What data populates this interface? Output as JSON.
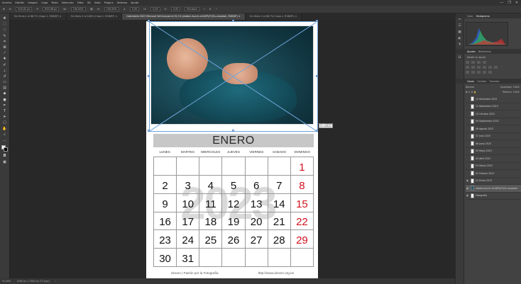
{
  "menubar": {
    "items": [
      "Archivo",
      "Edición",
      "Imagen",
      "Capa",
      "Texto",
      "Selección",
      "Filtro",
      "3D",
      "Vista",
      "Plugins",
      "Ventana",
      "Ayuda"
    ],
    "window_buttons": [
      "—",
      "❐",
      "✕"
    ]
  },
  "options_bar": {
    "fields": [
      "X:",
      "403,02 px",
      "Y:",
      "623,08 px",
      "W:",
      "100,00%",
      "H:",
      "100,00%",
      "0,00",
      "H:",
      "0,00",
      "V:",
      "0,00",
      "Bicúbica"
    ]
  },
  "doc_tabs": [
    {
      "label": "Sin título-1 al 66,7% (Capa 1, RGB/8*) ×",
      "active": false
    },
    {
      "label": "Sin título-2 al 100% (Capa 1, RGB/8*) ×",
      "active": false
    },
    {
      "label": "Calendario 2023 Mensual Vertical.psd al 92,1% (adobe-mucric-ml4DPyF2j3s-unsplash, RGB/8*) ×",
      "active": true
    },
    {
      "label": "Sin título-3 al 66,7% (Capa 1, RGB/8*) ×",
      "active": false
    }
  ],
  "status_bar": {
    "zoom": "92,08%",
    "doc_info": "1000 px x 1300 px (72 ppp)"
  },
  "transform_info": {
    "line1": "An.: 1345 px",
    "line2": "Al.: 1195 px"
  },
  "calendar": {
    "month": "ENERO",
    "day_names": [
      "LUNES",
      "MARTES",
      "MIERCOLES",
      "JUEVES",
      "VIERNES",
      "SABADO",
      "DOMINGO"
    ],
    "weeks": [
      [
        "",
        "",
        "",
        "",
        "",
        "",
        "1"
      ],
      [
        "2",
        "3",
        "4",
        "5",
        "6",
        "7",
        "8"
      ],
      [
        "9",
        "10",
        "11",
        "12",
        "13",
        "14",
        "15"
      ],
      [
        "16",
        "17",
        "18",
        "19",
        "20",
        "21",
        "22"
      ],
      [
        "23",
        "24",
        "25",
        "26",
        "27",
        "28",
        "29"
      ],
      [
        "30",
        "31",
        "",
        "",
        "",
        "",
        ""
      ]
    ],
    "watermark_year": "2023",
    "footer_left": "dzoom | Pasión por la Fotografía",
    "footer_right": "http://www.dzoom.org.es",
    "sunday_color": "#d2121e"
  },
  "right_panel": {
    "top_tabs": [
      "Color",
      "Histograma"
    ],
    "adjust_tabs": [
      "Ajustes",
      "Bibliotecas"
    ],
    "adjust_label": "Añadir un ajuste",
    "layer_tabs": [
      "Capas",
      "Canales",
      "Trazados"
    ],
    "blend_mode": "Normal",
    "opacity": "Opacidad: 100%",
    "fill": "Relleno: 100%",
    "layers": [
      {
        "name": "12 Diciembre 2023",
        "selected": false
      },
      {
        "name": "11 Noviembre 2023",
        "selected": false
      },
      {
        "name": "10 Octubre 2023",
        "selected": false
      },
      {
        "name": "09 Septiembre 2023",
        "selected": false
      },
      {
        "name": "08 Agosto 2023",
        "selected": false
      },
      {
        "name": "07 Julio 2023",
        "selected": false
      },
      {
        "name": "06 Junio 2023",
        "selected": false
      },
      {
        "name": "05 Mayo 2023",
        "selected": false
      },
      {
        "name": "04 Abril 2023",
        "selected": false
      },
      {
        "name": "03 Marzo 2023",
        "selected": false
      },
      {
        "name": "02 Febrero 2023",
        "selected": false
      },
      {
        "name": "01 Enero 2023",
        "selected": false
      },
      {
        "name": "adobe-mucric-ml4DPyF2j3s-unsplash",
        "selected": true
      },
      {
        "name": "Fotografía",
        "selected": false
      }
    ]
  }
}
